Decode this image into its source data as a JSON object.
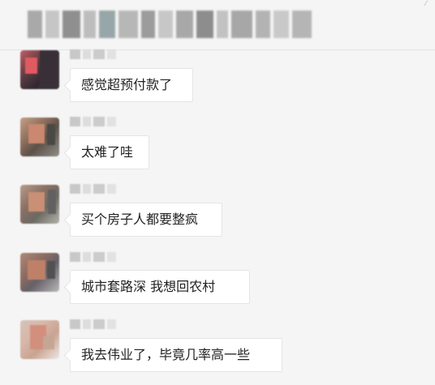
{
  "chat": {
    "messages": [
      {
        "text": "感觉超预付款了"
      },
      {
        "text": "太难了哇"
      },
      {
        "text": "买个房子人都要整疯"
      },
      {
        "text": "城市套路深   我想回农村"
      },
      {
        "text": "我去伟业了，毕竟几率高一些"
      }
    ]
  },
  "colors": {
    "background": "#f5f5f5",
    "bubble": "#ffffff",
    "text": "#222222"
  }
}
